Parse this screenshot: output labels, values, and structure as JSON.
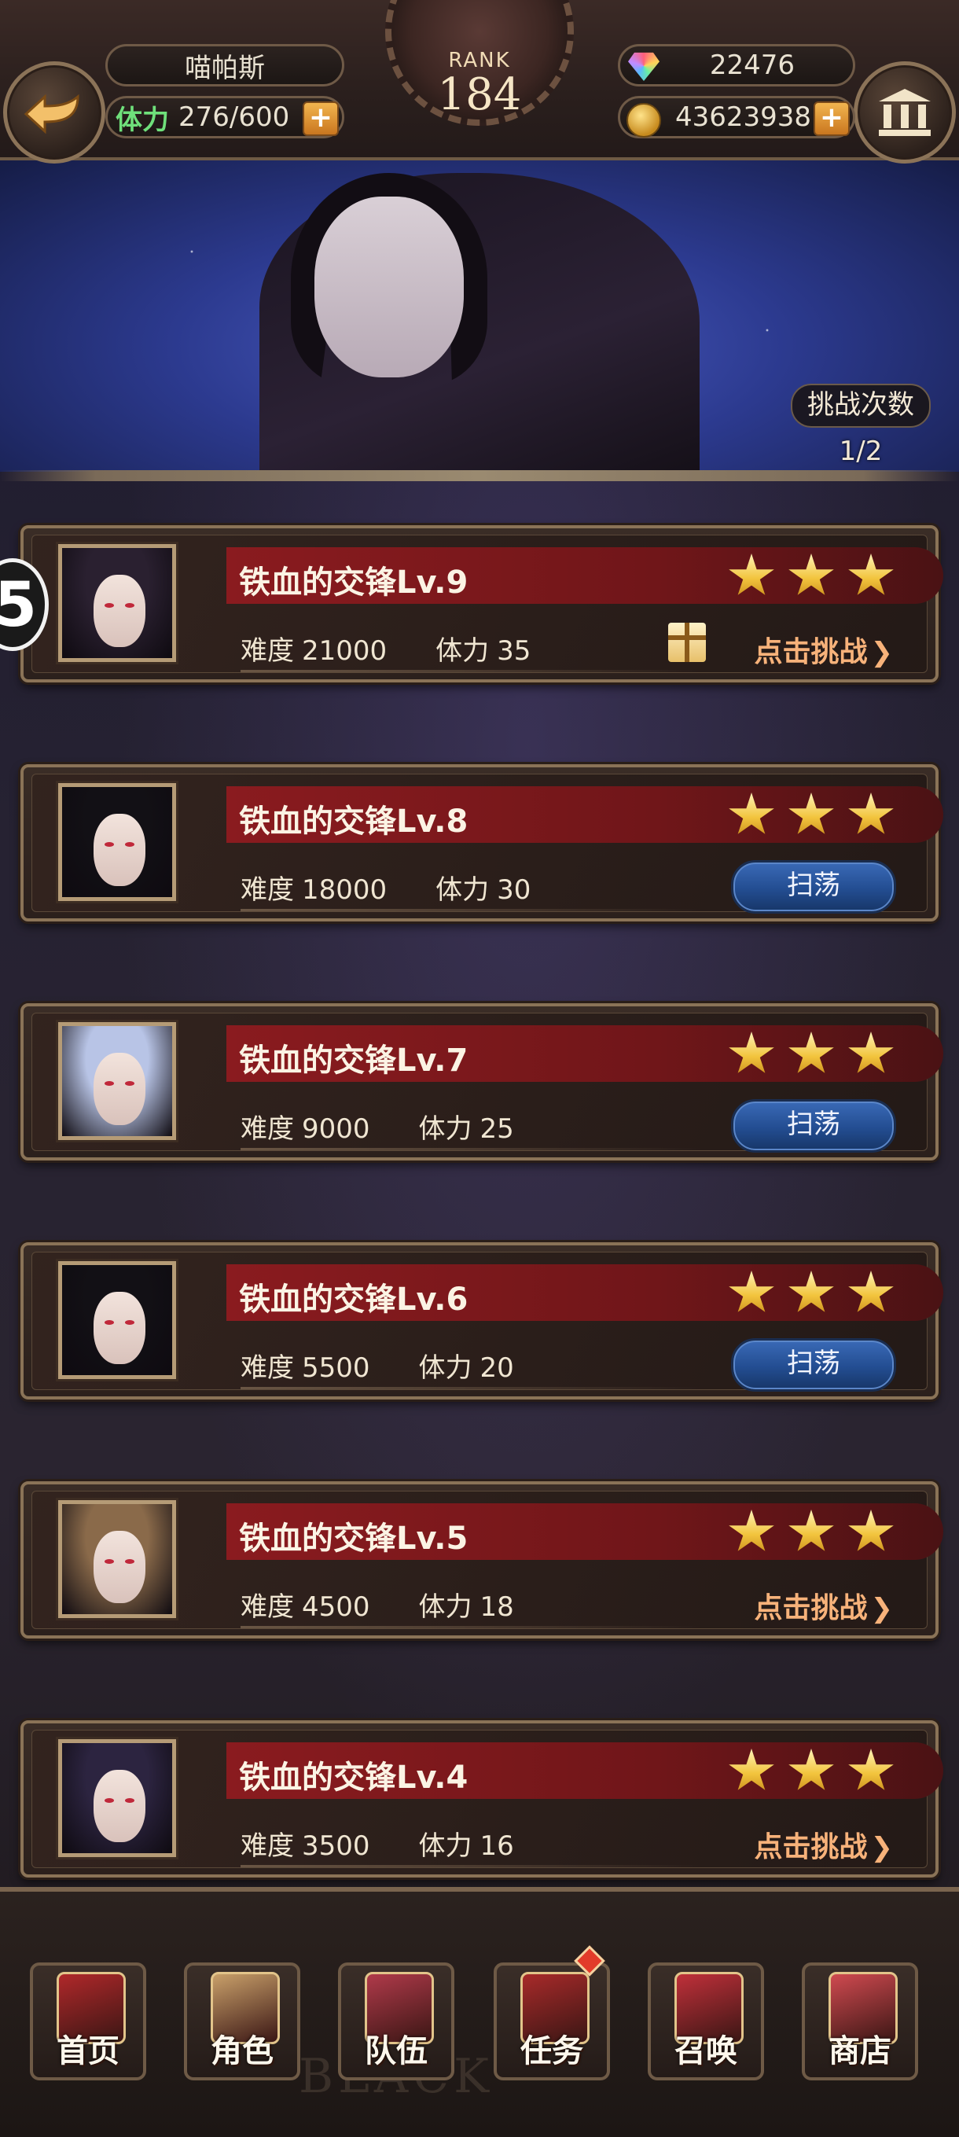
{
  "header": {
    "player_name": "喵帕斯",
    "stamina_label": "体力",
    "stamina_value": "276/600",
    "rank_label": "RANK",
    "rank_value": "184",
    "gems": "22476",
    "gold": "43623938"
  },
  "banner": {
    "challenge_title": "挑战次数",
    "challenge_count": "1/2"
  },
  "side_marker": "5",
  "stages": [
    {
      "title": "铁血的交锋Lv.9",
      "difficulty_label": "难度",
      "difficulty": "21000",
      "stamina_label": "体力",
      "stamina": "35",
      "stars": 3,
      "action": "点击挑战",
      "action_type": "challenge",
      "has_gift": true,
      "hair_color": "#2a2030"
    },
    {
      "title": "铁血的交锋Lv.8",
      "difficulty_label": "难度",
      "difficulty": "18000",
      "stamina_label": "体力",
      "stamina": "30",
      "stars": 3,
      "action": "扫荡",
      "action_type": "sweep",
      "has_gift": false,
      "hair_color": "#121015"
    },
    {
      "title": "铁血的交锋Lv.7",
      "difficulty_label": "难度",
      "difficulty": "9000",
      "stamina_label": "体力",
      "stamina": "25",
      "stars": 3,
      "action": "扫荡",
      "action_type": "sweep",
      "has_gift": false,
      "hair_color": "#b8c4e6"
    },
    {
      "title": "铁血的交锋Lv.6",
      "difficulty_label": "难度",
      "difficulty": "5500",
      "stamina_label": "体力",
      "stamina": "20",
      "stars": 3,
      "action": "扫荡",
      "action_type": "sweep",
      "has_gift": false,
      "hair_color": "#121015"
    },
    {
      "title": "铁血的交锋Lv.5",
      "difficulty_label": "难度",
      "difficulty": "4500",
      "stamina_label": "体力",
      "stamina": "18",
      "stars": 3,
      "action": "点击挑战",
      "action_type": "challenge",
      "has_gift": false,
      "hair_color": "#8a6a4a"
    },
    {
      "title": "铁血的交锋Lv.4",
      "difficulty_label": "难度",
      "difficulty": "3500",
      "stamina_label": "体力",
      "stamina": "16",
      "stars": 3,
      "action": "点击挑战",
      "action_type": "challenge",
      "has_gift": false,
      "hair_color": "#2c2440"
    }
  ],
  "nav": [
    {
      "label": "首页",
      "icon": "home-banner-icon",
      "color": "#b0282a"
    },
    {
      "label": "角色",
      "icon": "character-card-icon",
      "color": "#c9a06a"
    },
    {
      "label": "队伍",
      "icon": "team-emblem-icon",
      "color": "#b03a4a"
    },
    {
      "label": "任务",
      "icon": "quest-book-icon",
      "color": "#a82a2a",
      "badge": true
    },
    {
      "label": "召唤",
      "icon": "summon-card-icon",
      "color": "#c0303a"
    },
    {
      "label": "商店",
      "icon": "shop-gem-icon",
      "color": "#d04a50"
    }
  ],
  "nav_watermark": "BLACK"
}
